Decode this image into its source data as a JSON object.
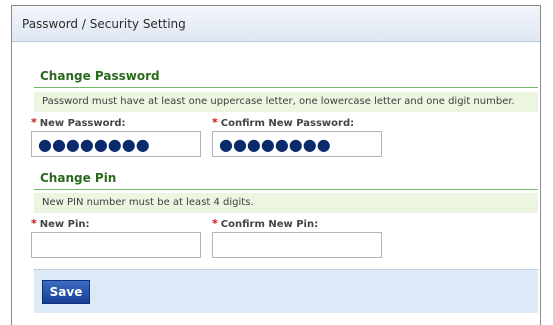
{
  "header": {
    "title": "Password / Security Setting"
  },
  "change_password": {
    "title": "Change Password",
    "hint": "Password must have at least one uppercase letter, one lowercase letter and one digit number.",
    "new_label": "New Password:",
    "confirm_label": "Confirm New Password:",
    "new_value": "●●●●●●●●",
    "confirm_value": "●●●●●●●●"
  },
  "change_pin": {
    "title": "Change Pin",
    "hint": "New PIN number must be at least 4 digits.",
    "new_label": "New Pin:",
    "confirm_label": "Confirm New Pin:",
    "new_value": "",
    "confirm_value": ""
  },
  "required_marker": "*",
  "save_label": "Save",
  "colors": {
    "section_title": "#2a6a1f",
    "hint_bg": "#ebf5e0",
    "required": "#d01010",
    "save_button": "#1e4aa0"
  }
}
